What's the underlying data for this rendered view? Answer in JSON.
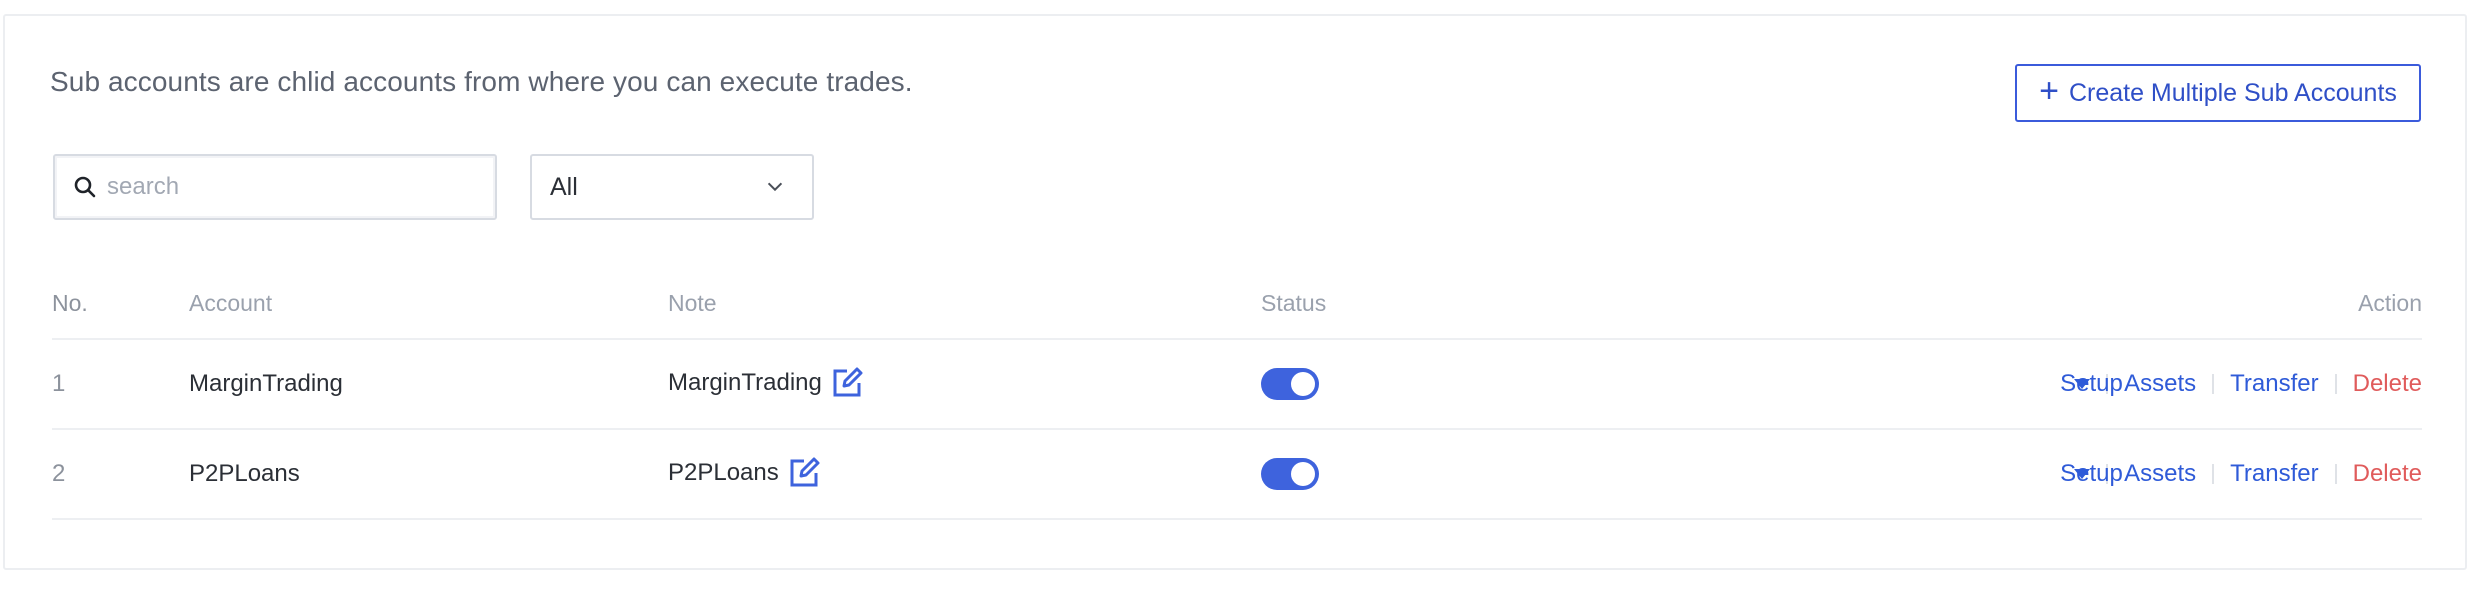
{
  "intro_text": "Sub accounts are chlid accounts from where you can execute trades.",
  "create_button": {
    "label": "Create Multiple Sub Accounts",
    "icon": "plus-icon"
  },
  "search": {
    "placeholder": "search",
    "value": "",
    "icon": "search-icon"
  },
  "filter": {
    "selected": "All",
    "icon": "chevron-down-icon"
  },
  "table": {
    "headers": {
      "no": "No.",
      "account": "Account",
      "note": "Note",
      "status": "Status",
      "action": "Action"
    },
    "rows": [
      {
        "no": "1",
        "account": "MarginTrading",
        "note": "MarginTrading",
        "status": "on",
        "actions": {
          "setup": "Setup",
          "assets": "Assets",
          "transfer": "Transfer",
          "delete": "Delete"
        }
      },
      {
        "no": "2",
        "account": "P2PLoans",
        "note": "P2PLoans",
        "status": "on",
        "actions": {
          "setup": "Setup",
          "assets": "Assets",
          "transfer": "Transfer",
          "delete": "Delete"
        }
      }
    ]
  },
  "colors": {
    "accent": "#2f5bd8",
    "toggle_on": "#3e63dd",
    "danger": "#e05b5b"
  }
}
